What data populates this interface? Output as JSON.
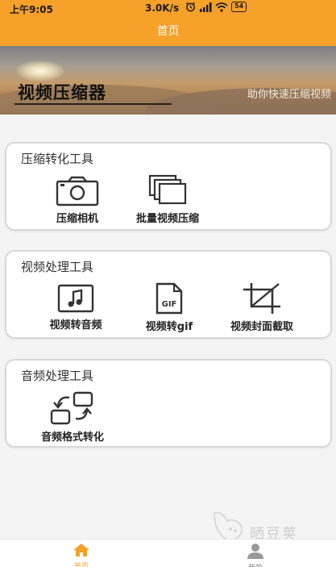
{
  "status_bar": {
    "time": "上午9:05",
    "speed": "3.0K/s",
    "battery": "54"
  },
  "app_bar": {
    "title": "首页"
  },
  "banner": {
    "title": "视频压缩器",
    "subtitle": "助你快速压缩视频"
  },
  "sections": [
    {
      "title": "压缩转化工具",
      "tools": [
        {
          "label": "压缩相机",
          "icon": "camera-icon"
        },
        {
          "label": "批量视频压缩",
          "icon": "batch-files-icon"
        }
      ]
    },
    {
      "title": "视频处理工具",
      "tools": [
        {
          "label": "视频转音频",
          "icon": "music-note-icon"
        },
        {
          "label": "视频转gif",
          "icon": "gif-file-icon"
        },
        {
          "label": "视频封面截取",
          "icon": "crop-icon"
        }
      ]
    },
    {
      "title": "音频处理工具",
      "tools": [
        {
          "label": "音频格式转化",
          "icon": "convert-icon"
        }
      ]
    }
  ],
  "gif_icon_text": "GIF",
  "bottom_nav": {
    "items": [
      {
        "label": "首页",
        "icon": "home-icon",
        "active": true
      },
      {
        "label": "我的",
        "icon": "user-icon",
        "active": false
      }
    ]
  },
  "watermark": {
    "text": "晒豆荚"
  },
  "colors": {
    "accent": "#f5a12a",
    "card_border": "#d8d8d8",
    "icon": "#333333"
  }
}
